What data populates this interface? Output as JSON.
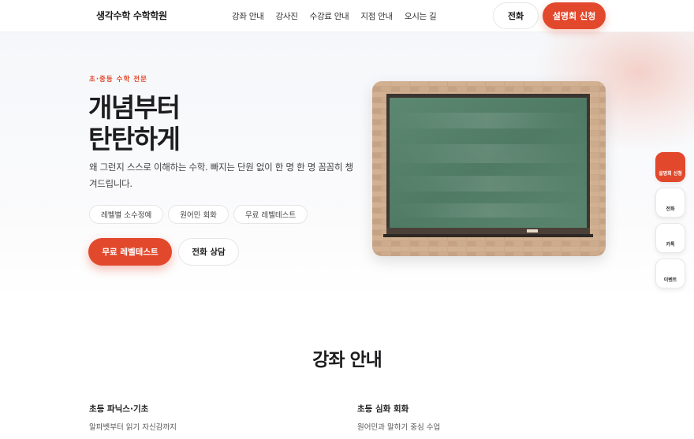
{
  "header": {
    "logo": "생각수학 수학학원",
    "nav": [
      "강좌 안내",
      "강사진",
      "수강료 안내",
      "지점 안내",
      "오시는 길"
    ],
    "call_label": "전화",
    "seminar_label": "설명회 신청"
  },
  "hero": {
    "eyebrow": "초·중등 수학 전문",
    "title_line1": "개념부터",
    "title_line2": "탄탄하게",
    "description": "왜 그런지 스스로 이해하는 수학. 빠지는 단원 없이 한 명 한 명 꼼꼼히 챙겨드립니다.",
    "chips": [
      "레벨별 소수정예",
      "원어민 회화",
      "무료 레벨테스트"
    ],
    "primary_cta": "무료 레벨테스트",
    "secondary_cta": "전화 상담"
  },
  "quick_menu": [
    "설명회 신청",
    "전화",
    "카톡",
    "이벤트"
  ],
  "courses": {
    "section_title": "강좌 안내",
    "items": [
      {
        "name": "초등 파닉스·기초",
        "desc": "알파벳부터 읽기 자신감까지"
      },
      {
        "name": "초등 심화 회화",
        "desc": "원어민과 말하기 중심 수업"
      }
    ]
  },
  "colors": {
    "accent": "#e2492c",
    "text": "#1d1d1f",
    "board": "#3f6b55"
  }
}
